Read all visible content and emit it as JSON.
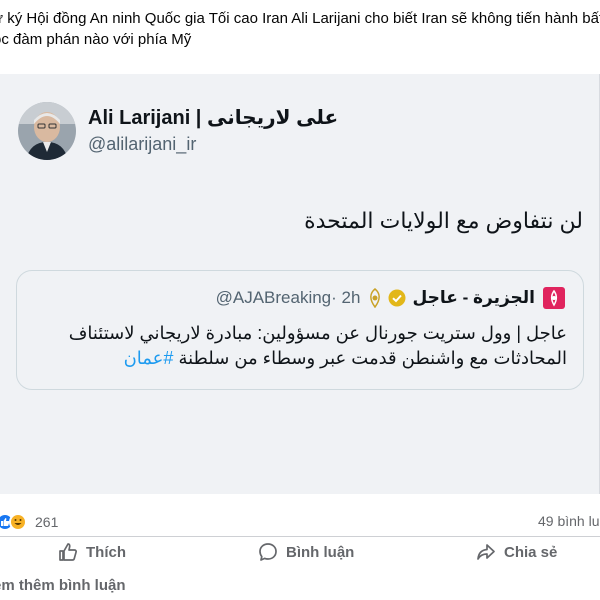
{
  "post": {
    "text_line1": "ư ký Hội đồng An ninh Quốc gia Tối cao Iran Ali Larijani cho biết Iran sẽ không tiến hành bất k",
    "text_line2": "ộc đàm phán nào với phía Mỹ"
  },
  "tweet": {
    "display_name_latin": "Ali Larijani | ",
    "display_name_arabic": "علی لاریجانی",
    "handle": "@alilarijani_ir",
    "text": "لن نتفاوض مع الولايات المتحدة"
  },
  "quote": {
    "name": "الجزيرة - عاجل",
    "handle": "@AJABreaking",
    "time": "· 2h",
    "body_line1": "عاجل | وول ستريت جورنال عن مسؤولين: مبادرة لاريجاني لاستئناف",
    "body_line2": "المحادثات مع واشنطن قدمت عبر وسطاء من سلطنة ",
    "hashtag": "#عمان"
  },
  "stats": {
    "reaction_count": "261",
    "comment_count": "49 bình lu"
  },
  "actions": {
    "like": "Thích",
    "comment": "Bình luận",
    "share": "Chia sẻ"
  },
  "more_comments": "em thêm bình luận",
  "colors": {
    "like_blue": "#1877f2",
    "haha_yellow": "#f7b125",
    "link_blue": "#1d9bf0",
    "aljazeera_red": "#e0245e",
    "verified_gold": "#e2b719"
  },
  "icons": [
    "like-reaction-icon",
    "haha-reaction-icon",
    "thumbs-up-icon",
    "comment-bubble-icon",
    "share-arrow-icon",
    "verified-badge-icon",
    "aljazeera-logo-icon"
  ]
}
